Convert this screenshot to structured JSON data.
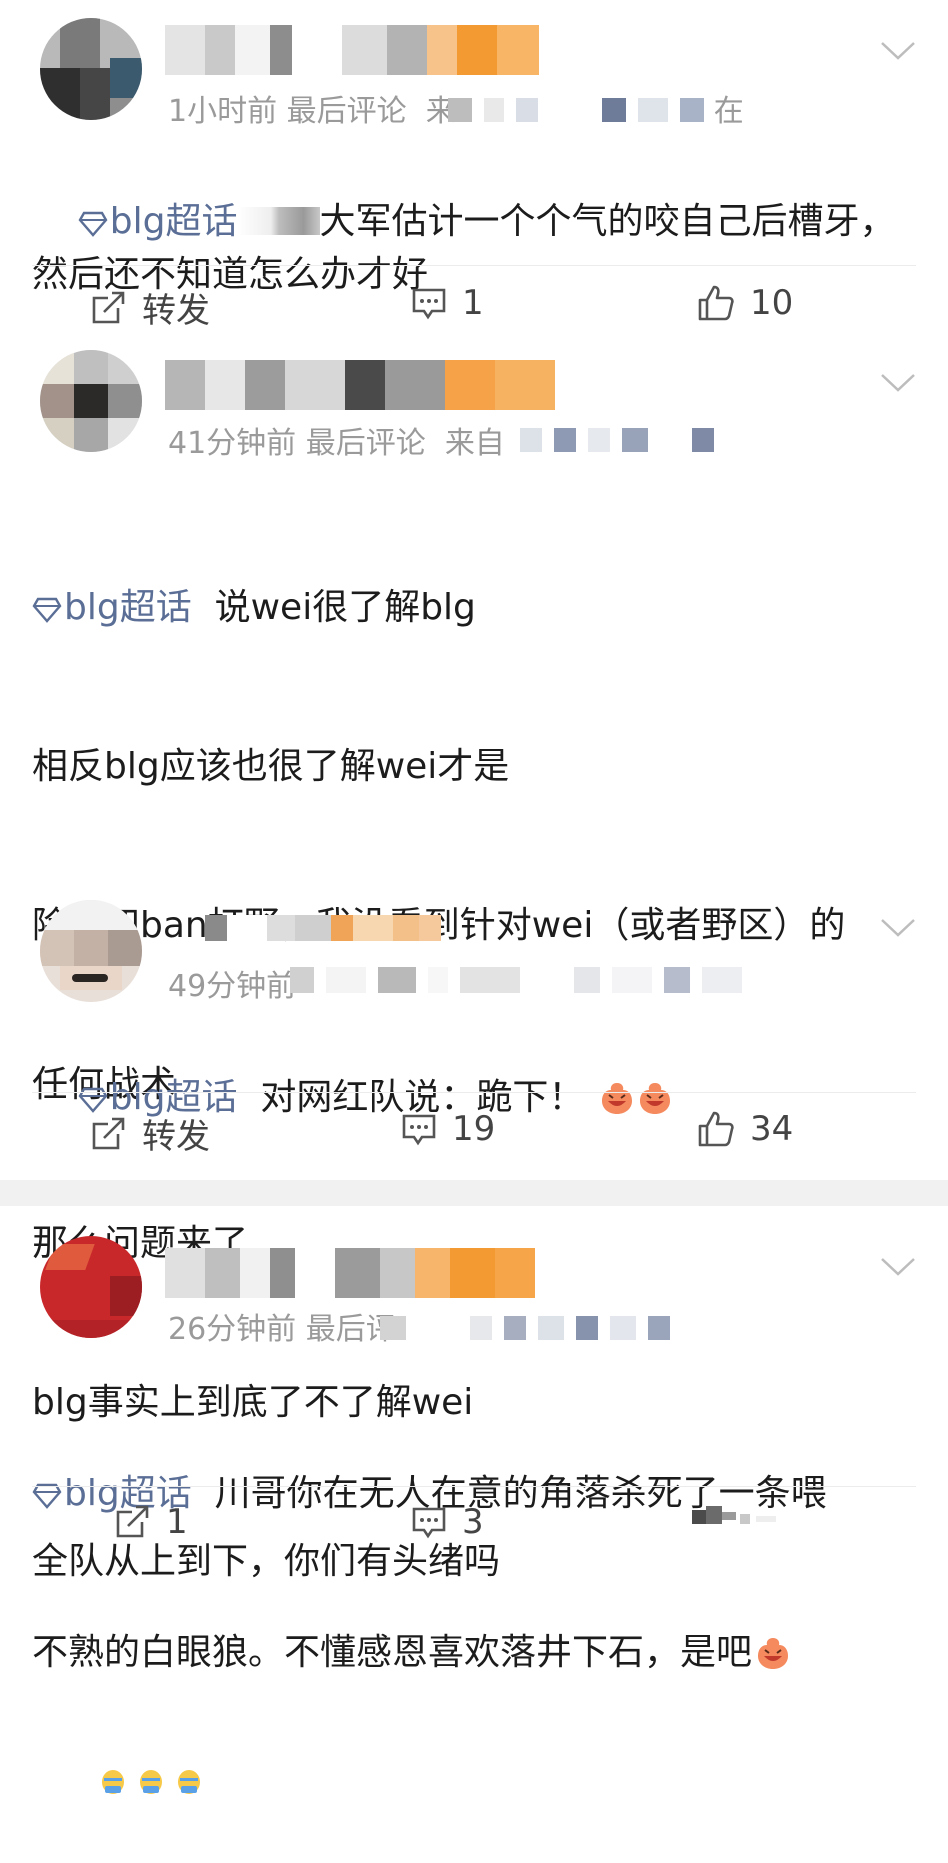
{
  "posts": [
    {
      "time": "1小时前",
      "last_comment": "最后评论",
      "source_prefix": "来",
      "source_suffix": "在",
      "topic": "blg超话",
      "text_after_blur": "大军估计一个个气的咬自己后槽牙，然后还不知道怎么办才好",
      "actions": {
        "repost": "转发",
        "comments": "1",
        "likes": "10"
      }
    },
    {
      "time": "41分钟前",
      "last_comment": "最后评论",
      "source_prefix": "来自",
      "topic": "blg超话",
      "lines": [
        "说wei很了解blg",
        "相反blg应该也很了解wei才是",
        "除了四ban打野，我没看到针对wei（或者野区）的",
        "任何战术",
        "那么问题来了",
        "blg事实上到底了不了解wei",
        "全队从上到下，你们有头绪吗"
      ]
    },
    {
      "time": "49分钟前",
      "topic": "blg超话",
      "text": "对网红队说：跪下！",
      "actions": {
        "repost": "转发",
        "comments": "19",
        "likes": "34"
      }
    },
    {
      "time": "26分钟前",
      "last_comment": "最后评",
      "topic": "blg超话",
      "text_line1": "川哥你在无人在意的角落杀死了一条喂",
      "text_line2": "不熟的白眼狼。不懂感恩喜欢落井下石，是吧",
      "actions": {
        "reposts": "1",
        "comments": "3"
      }
    }
  ],
  "colors": {
    "topic": "#5a6e96",
    "meta": "#9a9a9a",
    "orange_blur": "#f7a342"
  }
}
